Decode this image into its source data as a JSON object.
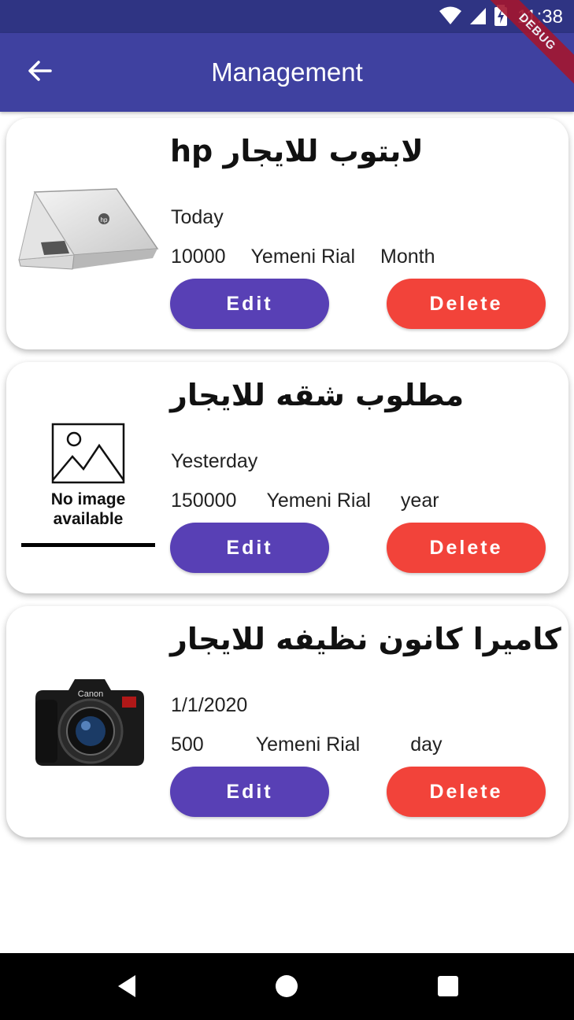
{
  "status_bar": {
    "time": "11:38",
    "icons": [
      "wifi-icon",
      "signal-icon",
      "battery-charging-icon"
    ]
  },
  "app_bar": {
    "title": "Management",
    "back_icon": "arrow-back-icon"
  },
  "debug_banner": "DEBUG",
  "colors": {
    "status_bar": "#2f3483",
    "app_bar": "#3f41a0",
    "edit_button": "#5840b5",
    "delete_button": "#f2433a",
    "debug_ribbon": "#a3162f"
  },
  "items": [
    {
      "title": "لابتوب للايجار hp",
      "date": "Today",
      "price": "10000",
      "currency": "Yemeni Rial",
      "period": "Month",
      "image": "laptop-image",
      "edit_label": "Edit",
      "delete_label": "Delete"
    },
    {
      "title": "مطلوب شقه للايجار",
      "date": "Yesterday",
      "price": "150000",
      "currency": "Yemeni Rial",
      "period": "year",
      "image": "no-image-placeholder",
      "image_caption_line1": "No image",
      "image_caption_line2": "available",
      "edit_label": "Edit",
      "delete_label": "Delete"
    },
    {
      "title": "كاميرا كانون نظيفه للايجار",
      "date": "1/1/2020",
      "price": "500",
      "currency": "Yemeni Rial",
      "period": "day",
      "image": "camera-image",
      "edit_label": "Edit",
      "delete_label": "Delete"
    }
  ],
  "nav_bar": {
    "buttons": [
      "back-triangle-icon",
      "home-circle-icon",
      "recents-square-icon"
    ]
  }
}
